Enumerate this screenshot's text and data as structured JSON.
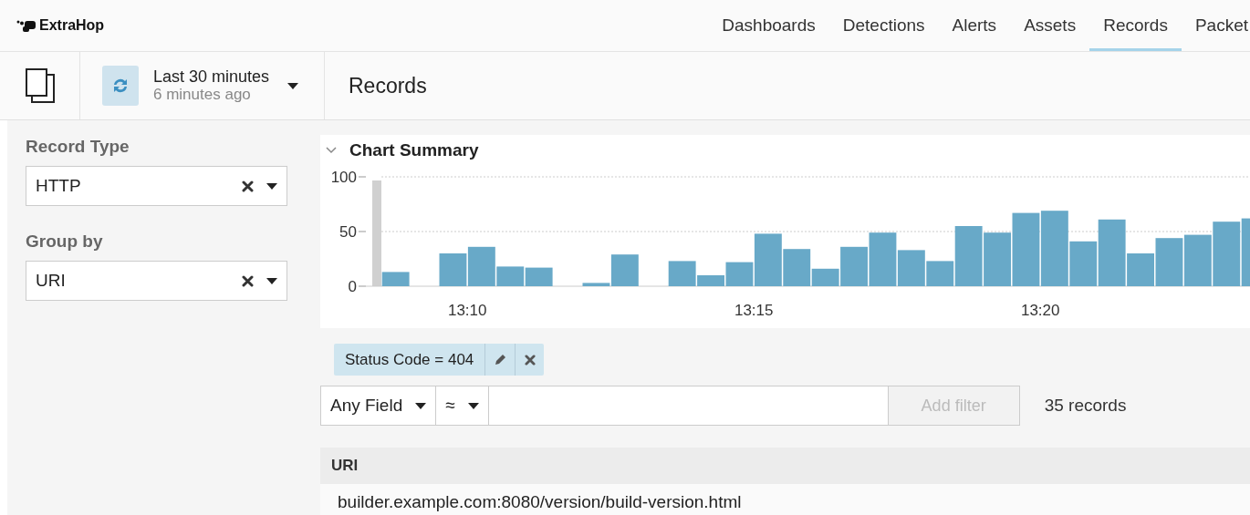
{
  "brand": {
    "name": "ExtraHop"
  },
  "nav": [
    {
      "label": "Dashboards",
      "selected": false
    },
    {
      "label": "Detections",
      "selected": false
    },
    {
      "label": "Alerts",
      "selected": false
    },
    {
      "label": "Assets",
      "selected": false
    },
    {
      "label": "Records",
      "selected": true
    },
    {
      "label": "Packet",
      "selected": false
    }
  ],
  "toolbar": {
    "time_range": "Last 30 minutes",
    "updated": "6 minutes ago",
    "page_title": "Records"
  },
  "sidebar": {
    "fields": [
      {
        "label": "Record Type",
        "value": "HTTP"
      },
      {
        "label": "Group by",
        "value": "URI"
      }
    ]
  },
  "chart_summary": {
    "title": "Chart Summary",
    "expanded": true,
    "chart_data": {
      "type": "bar",
      "categories": [
        null,
        null,
        null,
        "13:10",
        null,
        null,
        null,
        null,
        null,
        null,
        null,
        null,
        null,
        "13:15",
        null,
        null,
        null,
        null,
        null,
        null,
        null,
        null,
        null,
        "13:20",
        null,
        null,
        null,
        null,
        null,
        null,
        null
      ],
      "series": [
        {
          "color": "#68a9c8",
          "values": [
            13,
            null,
            30,
            36,
            18,
            17,
            null,
            3,
            29,
            null,
            23,
            10,
            22,
            48,
            34,
            16,
            36,
            49,
            33,
            23,
            55,
            49,
            67,
            69,
            41,
            61,
            30,
            44,
            47,
            59,
            62
          ]
        }
      ],
      "ylim": [
        0,
        100
      ],
      "yticks": [
        0,
        50,
        100
      ],
      "grid": true
    }
  },
  "filters": [
    {
      "text": "Status Code = 404"
    }
  ],
  "filter_bar": {
    "field": "Any Field",
    "operator": "≈",
    "add_button": {
      "label": "Add filter",
      "disabled": true
    },
    "count": "35 records"
  },
  "table": {
    "columns": [
      "URI"
    ],
    "rows": [
      [
        "builder.example.com:8080/version/build-version.html"
      ]
    ]
  }
}
